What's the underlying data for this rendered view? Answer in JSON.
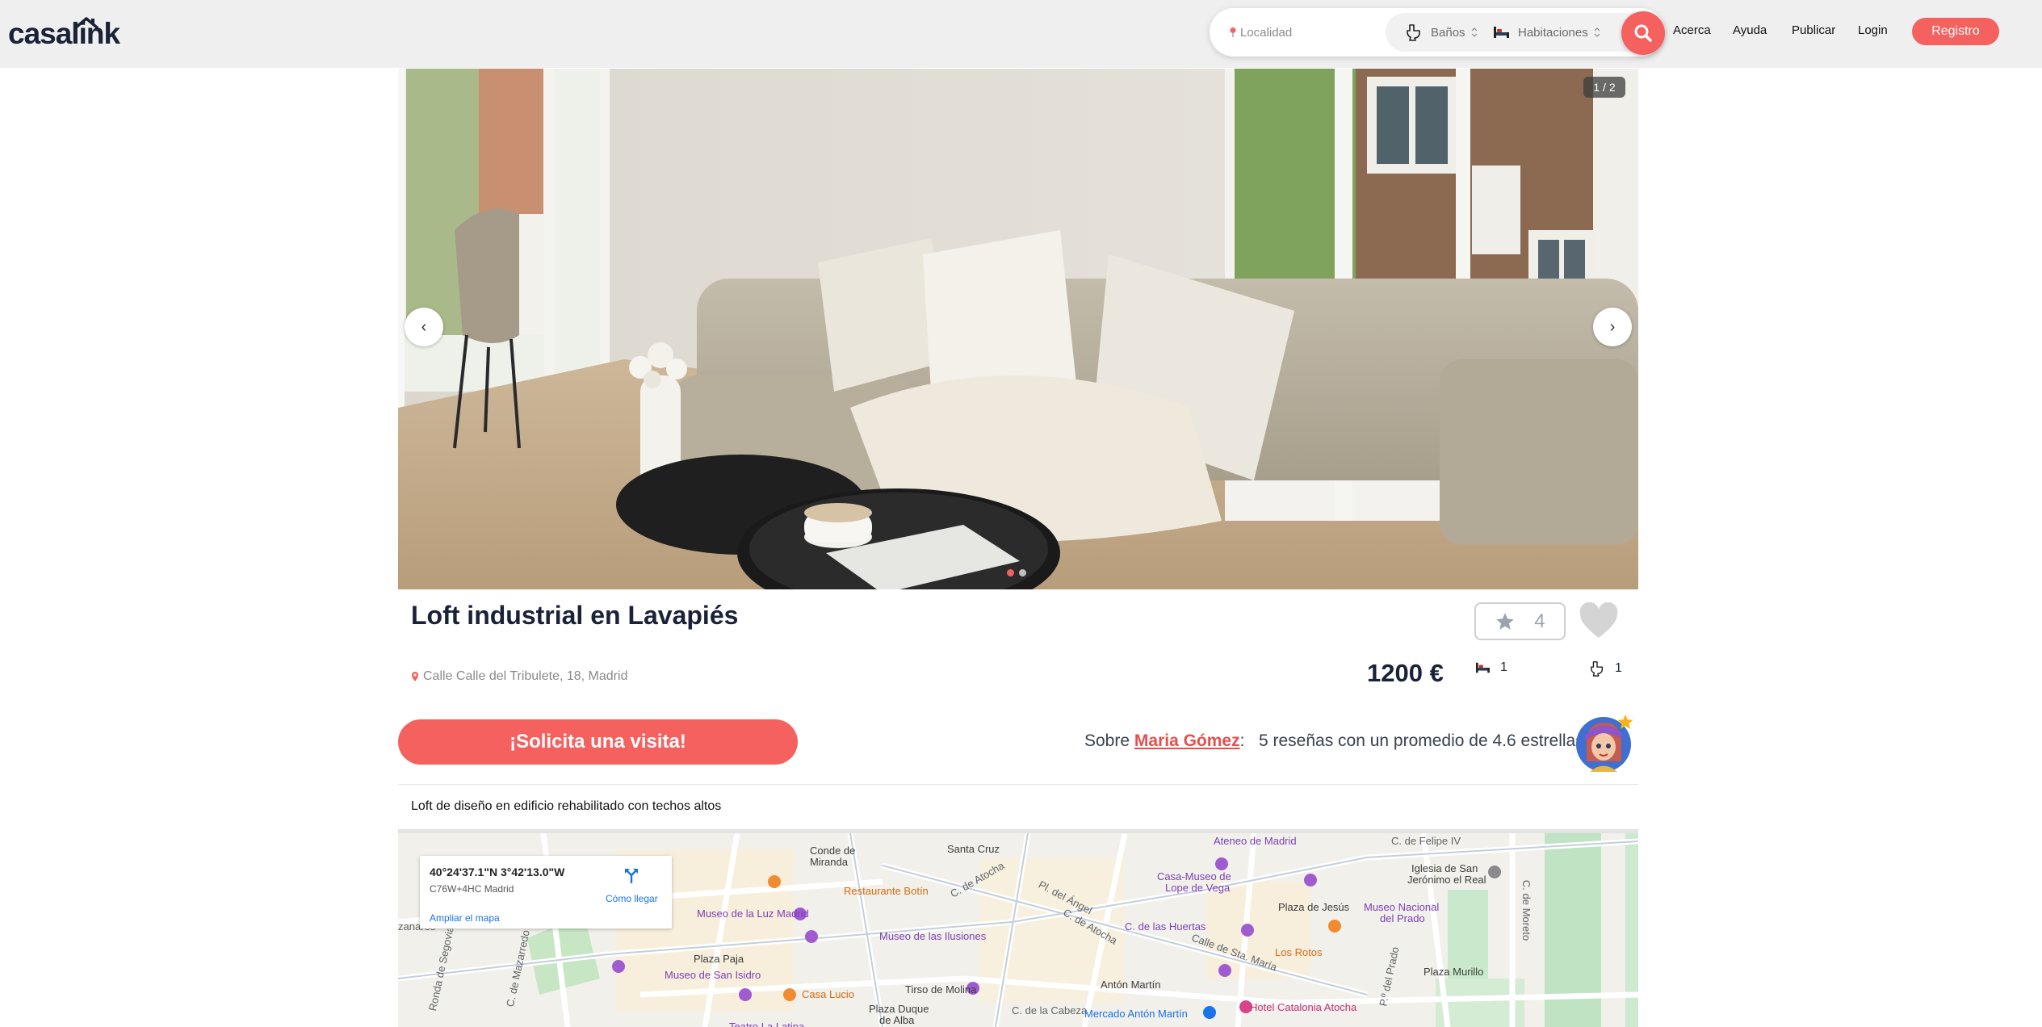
{
  "header": {
    "logo": "casalink",
    "search": {
      "location_placeholder": "Localidad",
      "baths_label": "Baños",
      "rooms_label": "Habitaciones"
    },
    "nav": [
      "Acerca",
      "Ayuda",
      "Publicar",
      "Login"
    ],
    "register_label": "Registro",
    "accent_color": "#f4615f"
  },
  "gallery": {
    "counter": "1 / 2",
    "prev_icon": "chevron-left-icon",
    "next_icon": "chevron-right-icon",
    "total": 2,
    "current": 1
  },
  "listing": {
    "title": "Loft industrial en Lavapiés",
    "address": "Calle Calle del Tribulete, 18, Madrid",
    "rating_count": "4",
    "price": "1200 €",
    "bedrooms": "1",
    "bathrooms": "1",
    "cta_label": "¡Solicita una visita!",
    "reviews": {
      "prefix": "Sobre",
      "owner": "Maria Gómez",
      "separator": ":",
      "summary": "5 reseñas con un promedio de 4.6 estrellas."
    },
    "description": "Loft de diseño en edificio rehabilitado con techos altos"
  },
  "map": {
    "coords": "40°24'37.1\"N 3°42'13.0\"W",
    "plus_code": "C76W+4HC Madrid",
    "directions": "Cómo llegar",
    "enlarge": "Ampliar el mapa",
    "labels": {
      "santa_cruz": "Santa Cruz",
      "conde_miranda_1": "Conde de",
      "conde_miranda_2": "Miranda",
      "atocha_1": "C. de Atocha",
      "atocha_2": "C. de Atocha",
      "pl_angel": "Pl. del Ángel",
      "botin": "Restaurante Botín",
      "casa_museo_1": "Casa-Museo de",
      "casa_museo_2": "Lope de Vega",
      "ateneo": "Ateneo de Madrid",
      "felipe": "C. de Felipe IV",
      "iglesia_1": "Iglesia de San",
      "iglesia_2": "Jerónimo el Real",
      "luz_madrid": "Museo de la Luz Madrid",
      "ilusiones": "Museo de las Ilusiones",
      "huertas": "C. de las Huertas",
      "plaza_jesus": "Plaza de Jesús",
      "museo_prado_1": "Museo Nacional",
      "museo_prado_2": "del Prado",
      "moreto": "C. de Moreto",
      "mazarredo": "C. de Mazarredo",
      "segovia": "Ronda de Segovia",
      "plaza_paja": "Plaza Paja",
      "san_isidro": "Museo de San Isidro",
      "sta_maria": "Calle de Sta. María",
      "los_rotos": "Los Rotos",
      "plaza_murillo": "Plaza Murillo",
      "pso_prado": "P.º del Prado",
      "anton_martin": "Antón Martín",
      "tirso": "Tirso de Molina",
      "casa_lucio": "Casa Lucio",
      "plaza_duque_1": "Plaza Duque",
      "plaza_duque_2": "de Alba",
      "cabeza": "C. de la Cabeza",
      "mercado": "Mercado Antón Martín",
      "hotel": "Hotel Catalonia Atocha",
      "zanares": "zanares",
      "lavapies_teatro": "Teatro La Latina"
    }
  }
}
